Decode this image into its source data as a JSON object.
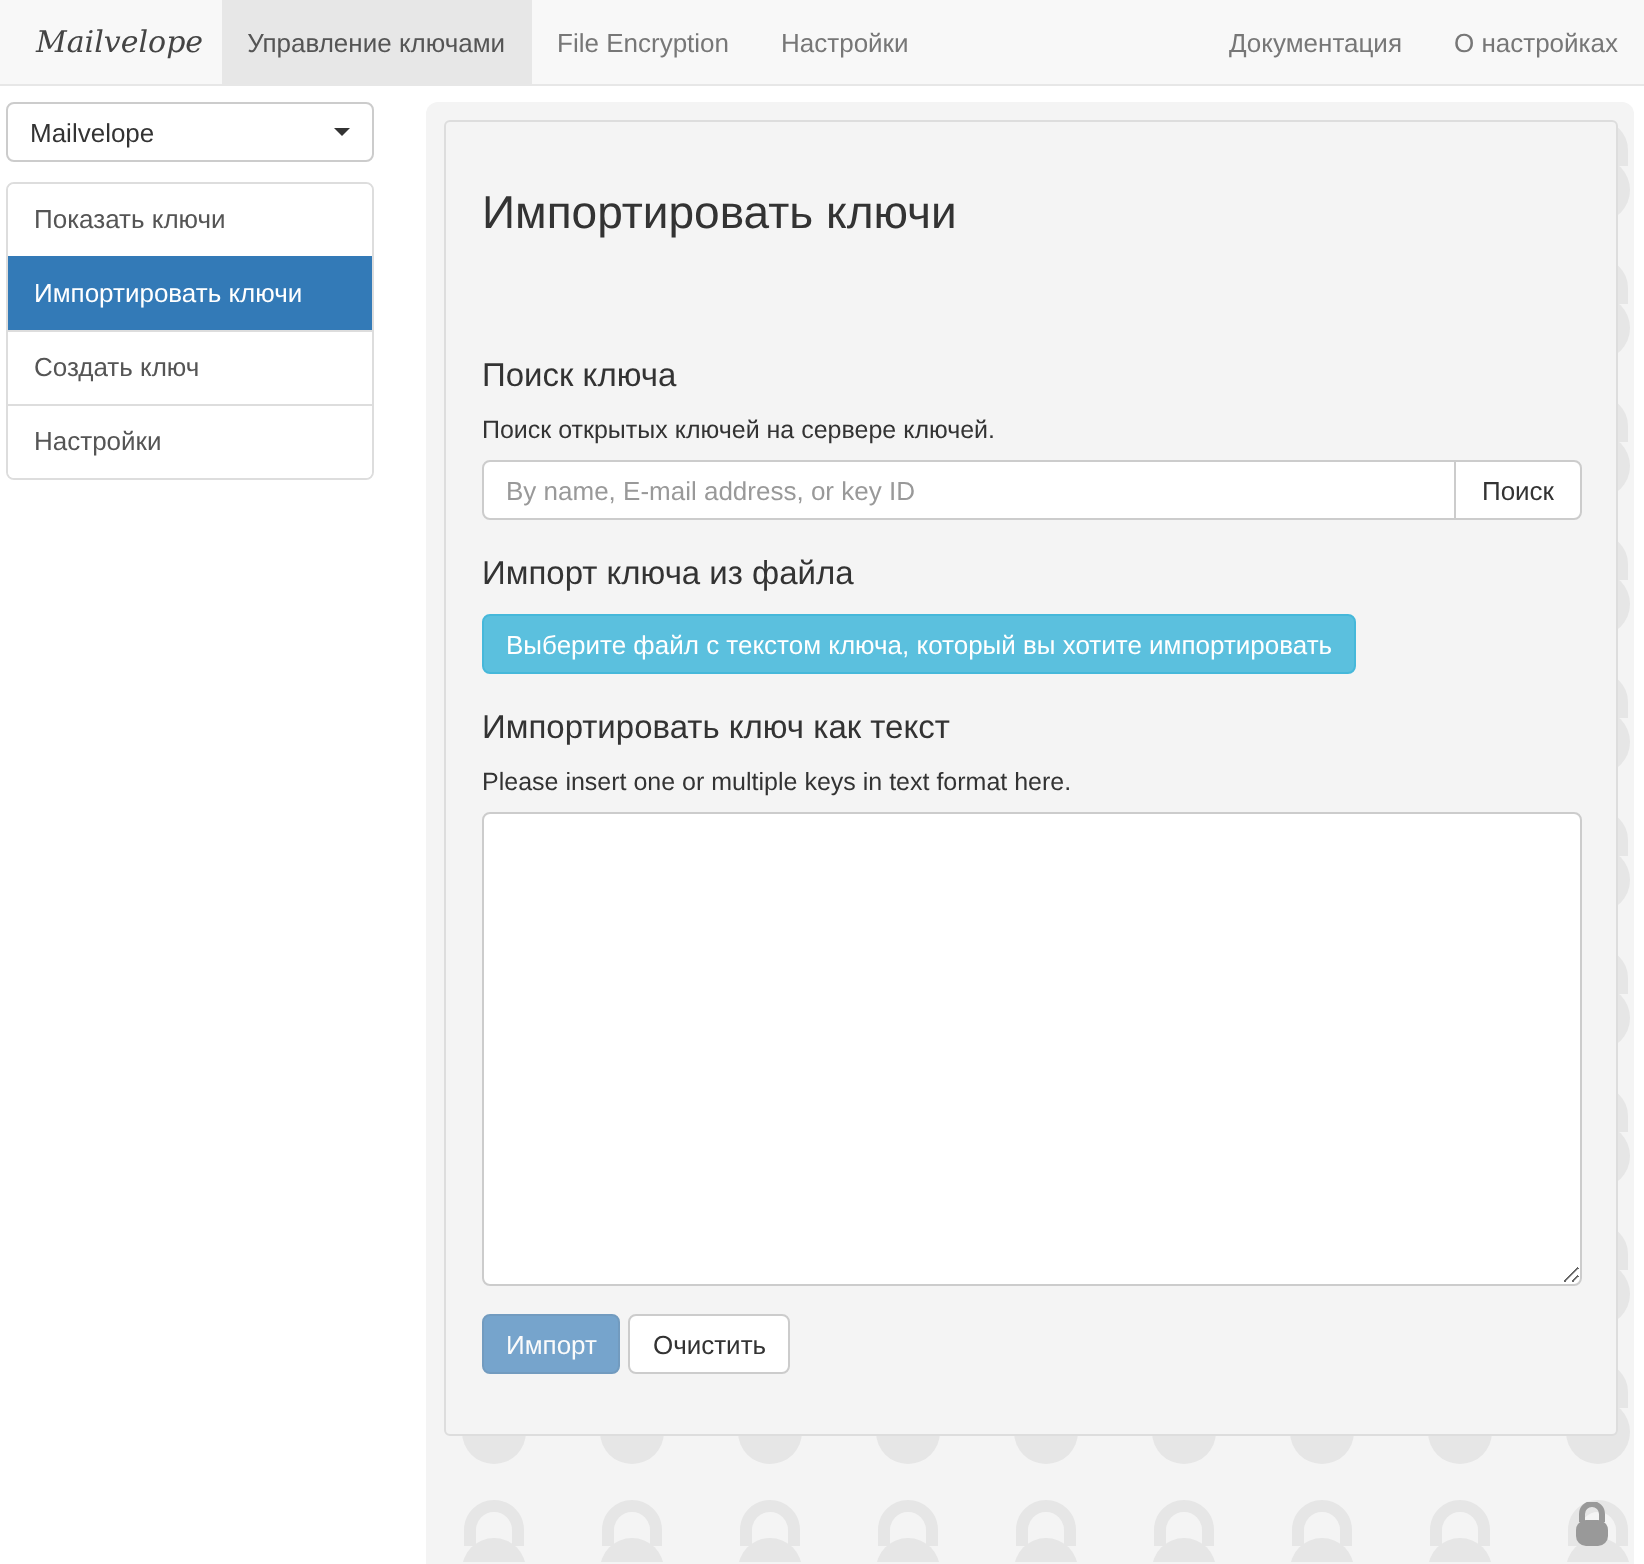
{
  "navbar": {
    "brand": "Mailvelope",
    "tabs": [
      {
        "label": "Управление ключами",
        "selected": true
      },
      {
        "label": "File Encryption",
        "selected": false
      },
      {
        "label": "Настройки",
        "selected": false
      }
    ],
    "right_links": [
      "Документация",
      "О настройках"
    ]
  },
  "sidebar": {
    "keyring": "Mailvelope",
    "items": [
      {
        "label": "Показать ключи",
        "selected": false
      },
      {
        "label": "Импортировать ключи",
        "selected": true
      },
      {
        "label": "Создать ключ",
        "selected": false
      },
      {
        "label": "Настройки",
        "selected": false
      }
    ]
  },
  "page": {
    "title": "Импортировать ключи",
    "search": {
      "heading": "Поиск ключа",
      "description": "Поиск открытых ключей на сервере ключей.",
      "placeholder": "By name, E-mail address, or key ID",
      "button": "Поиск"
    },
    "file_import": {
      "heading": "Импорт ключа из файла",
      "button": "Выберите файл с текстом ключа, который вы хотите импортировать"
    },
    "text_import": {
      "heading": "Импортировать ключ как текст",
      "description": "Please insert one or multiple keys in text format here.",
      "buttons": [
        {
          "label": "Импорт",
          "kind": "primary",
          "disabled": true
        },
        {
          "label": "Очистить",
          "kind": "default",
          "disabled": false
        }
      ]
    }
  }
}
